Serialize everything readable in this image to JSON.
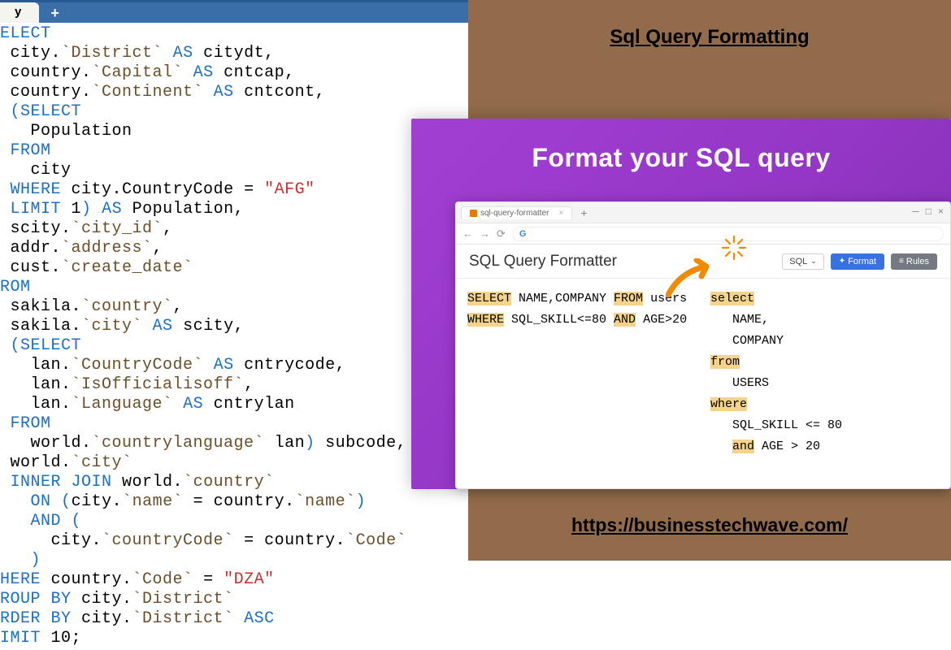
{
  "left": {
    "tab_label": "y",
    "add_tab_glyph": "+",
    "sql_tokens": [
      {
        "t": "kw",
        "v": "ELECT"
      },
      {
        "t": "nl"
      },
      {
        "t": "txt",
        "v": " city."
      },
      {
        "t": "id",
        "v": "`District`"
      },
      {
        "t": "txt",
        "v": " "
      },
      {
        "t": "kw",
        "v": "AS"
      },
      {
        "t": "txt",
        "v": " citydt,"
      },
      {
        "t": "nl"
      },
      {
        "t": "txt",
        "v": " country."
      },
      {
        "t": "id",
        "v": "`Capital`"
      },
      {
        "t": "txt",
        "v": " "
      },
      {
        "t": "kw",
        "v": "AS"
      },
      {
        "t": "txt",
        "v": " cntcap,"
      },
      {
        "t": "nl"
      },
      {
        "t": "txt",
        "v": " country."
      },
      {
        "t": "id",
        "v": "`Continent`"
      },
      {
        "t": "txt",
        "v": " "
      },
      {
        "t": "kw",
        "v": "AS"
      },
      {
        "t": "txt",
        "v": " cntcont,"
      },
      {
        "t": "nl"
      },
      {
        "t": "txt",
        "v": " "
      },
      {
        "t": "paren",
        "v": "("
      },
      {
        "t": "kw",
        "v": "SELECT"
      },
      {
        "t": "nl"
      },
      {
        "t": "txt",
        "v": "   Population"
      },
      {
        "t": "nl"
      },
      {
        "t": "txt",
        "v": " "
      },
      {
        "t": "kw",
        "v": "FROM"
      },
      {
        "t": "nl"
      },
      {
        "t": "txt",
        "v": "   city"
      },
      {
        "t": "nl"
      },
      {
        "t": "txt",
        "v": " "
      },
      {
        "t": "kw",
        "v": "WHERE"
      },
      {
        "t": "txt",
        "v": " city.CountryCode = "
      },
      {
        "t": "str",
        "v": "\"AFG\""
      },
      {
        "t": "nl"
      },
      {
        "t": "txt",
        "v": " "
      },
      {
        "t": "kw",
        "v": "LIMIT"
      },
      {
        "t": "txt",
        "v": " 1"
      },
      {
        "t": "paren",
        "v": ")"
      },
      {
        "t": "txt",
        "v": " "
      },
      {
        "t": "kw",
        "v": "AS"
      },
      {
        "t": "txt",
        "v": " Population,"
      },
      {
        "t": "nl"
      },
      {
        "t": "txt",
        "v": " scity."
      },
      {
        "t": "id",
        "v": "`city_id`"
      },
      {
        "t": "txt",
        "v": ","
      },
      {
        "t": "nl"
      },
      {
        "t": "txt",
        "v": " addr."
      },
      {
        "t": "id",
        "v": "`address`"
      },
      {
        "t": "txt",
        "v": ","
      },
      {
        "t": "nl"
      },
      {
        "t": "txt",
        "v": " cust."
      },
      {
        "t": "id",
        "v": "`create_date`"
      },
      {
        "t": "nl"
      },
      {
        "t": "kw",
        "v": "ROM"
      },
      {
        "t": "nl"
      },
      {
        "t": "txt",
        "v": " sakila."
      },
      {
        "t": "id",
        "v": "`country`"
      },
      {
        "t": "txt",
        "v": ","
      },
      {
        "t": "nl"
      },
      {
        "t": "txt",
        "v": " sakila."
      },
      {
        "t": "id",
        "v": "`city`"
      },
      {
        "t": "txt",
        "v": " "
      },
      {
        "t": "kw",
        "v": "AS"
      },
      {
        "t": "txt",
        "v": " scity,"
      },
      {
        "t": "nl"
      },
      {
        "t": "txt",
        "v": " "
      },
      {
        "t": "paren",
        "v": "("
      },
      {
        "t": "kw",
        "v": "SELECT"
      },
      {
        "t": "nl"
      },
      {
        "t": "txt",
        "v": "   lan."
      },
      {
        "t": "id",
        "v": "`CountryCode`"
      },
      {
        "t": "txt",
        "v": " "
      },
      {
        "t": "kw",
        "v": "AS"
      },
      {
        "t": "txt",
        "v": " cntrycode,"
      },
      {
        "t": "nl"
      },
      {
        "t": "txt",
        "v": "   lan."
      },
      {
        "t": "id",
        "v": "`IsOfficialisoff`"
      },
      {
        "t": "txt",
        "v": ","
      },
      {
        "t": "nl"
      },
      {
        "t": "txt",
        "v": "   lan."
      },
      {
        "t": "id",
        "v": "`Language`"
      },
      {
        "t": "txt",
        "v": " "
      },
      {
        "t": "kw",
        "v": "AS"
      },
      {
        "t": "txt",
        "v": " cntrylan"
      },
      {
        "t": "nl"
      },
      {
        "t": "txt",
        "v": " "
      },
      {
        "t": "kw",
        "v": "FROM"
      },
      {
        "t": "nl"
      },
      {
        "t": "txt",
        "v": "   world."
      },
      {
        "t": "id",
        "v": "`countrylanguage`"
      },
      {
        "t": "txt",
        "v": " lan"
      },
      {
        "t": "paren",
        "v": ")"
      },
      {
        "t": "txt",
        "v": " subcode,"
      },
      {
        "t": "nl"
      },
      {
        "t": "txt",
        "v": " world."
      },
      {
        "t": "id",
        "v": "`city`"
      },
      {
        "t": "nl"
      },
      {
        "t": "txt",
        "v": " "
      },
      {
        "t": "kw",
        "v": "INNER JOIN"
      },
      {
        "t": "txt",
        "v": " world."
      },
      {
        "t": "id",
        "v": "`country`"
      },
      {
        "t": "nl"
      },
      {
        "t": "txt",
        "v": "   "
      },
      {
        "t": "kw",
        "v": "ON"
      },
      {
        "t": "txt",
        "v": " "
      },
      {
        "t": "paren",
        "v": "("
      },
      {
        "t": "txt",
        "v": "city."
      },
      {
        "t": "id",
        "v": "`name`"
      },
      {
        "t": "txt",
        "v": " = country."
      },
      {
        "t": "id",
        "v": "`name`"
      },
      {
        "t": "paren",
        "v": ")"
      },
      {
        "t": "nl"
      },
      {
        "t": "txt",
        "v": "   "
      },
      {
        "t": "kw",
        "v": "AND"
      },
      {
        "t": "txt",
        "v": " "
      },
      {
        "t": "paren",
        "v": "("
      },
      {
        "t": "nl"
      },
      {
        "t": "txt",
        "v": "     city."
      },
      {
        "t": "id",
        "v": "`countryCode`"
      },
      {
        "t": "txt",
        "v": " = country."
      },
      {
        "t": "id",
        "v": "`Code`"
      },
      {
        "t": "nl"
      },
      {
        "t": "txt",
        "v": "   "
      },
      {
        "t": "paren",
        "v": ")"
      },
      {
        "t": "nl"
      },
      {
        "t": "kw",
        "v": "HERE"
      },
      {
        "t": "txt",
        "v": " country."
      },
      {
        "t": "id",
        "v": "`Code`"
      },
      {
        "t": "txt",
        "v": " = "
      },
      {
        "t": "str",
        "v": "\"DZA\""
      },
      {
        "t": "nl"
      },
      {
        "t": "kw",
        "v": "ROUP BY"
      },
      {
        "t": "txt",
        "v": " city."
      },
      {
        "t": "id",
        "v": "`District`"
      },
      {
        "t": "nl"
      },
      {
        "t": "kw",
        "v": "RDER BY"
      },
      {
        "t": "txt",
        "v": " city."
      },
      {
        "t": "id",
        "v": "`District`"
      },
      {
        "t": "txt",
        "v": " "
      },
      {
        "t": "kw",
        "v": "ASC"
      },
      {
        "t": "nl"
      },
      {
        "t": "kw",
        "v": "IMIT"
      },
      {
        "t": "txt",
        "v": " 10;"
      }
    ]
  },
  "right": {
    "title": "Sql Query Formatting",
    "url": "https://businesstechwave.com/"
  },
  "purple": {
    "headline": "Format your SQL query"
  },
  "browser": {
    "tab_title": "sql-query-formatter",
    "addr_text": "G",
    "app_title": "SQL Query Formatter",
    "select_label": "SQL",
    "format_btn": "Format",
    "rules_btn": "Rules",
    "input_tokens": [
      {
        "t": "hk",
        "v": "SELECT"
      },
      {
        "t": "txt",
        "v": " NAME,COMPANY "
      },
      {
        "t": "hk",
        "v": "FROM"
      },
      {
        "t": "txt",
        "v": " users"
      },
      {
        "t": "nl"
      },
      {
        "t": "hk",
        "v": "WHERE"
      },
      {
        "t": "txt",
        "v": " SQL_SKILL<=80 "
      },
      {
        "t": "hk",
        "v": "AND"
      },
      {
        "t": "txt",
        "v": " AGE>20"
      }
    ],
    "output_tokens": [
      {
        "t": "hk",
        "v": "select"
      },
      {
        "t": "nl"
      },
      {
        "t": "txt",
        "v": "   NAME,"
      },
      {
        "t": "nl"
      },
      {
        "t": "txt",
        "v": "   COMPANY"
      },
      {
        "t": "nl"
      },
      {
        "t": "hk",
        "v": "from"
      },
      {
        "t": "nl"
      },
      {
        "t": "txt",
        "v": "   USERS"
      },
      {
        "t": "nl"
      },
      {
        "t": "hk",
        "v": "where"
      },
      {
        "t": "nl"
      },
      {
        "t": "txt",
        "v": "   SQL_SKILL <= 80"
      },
      {
        "t": "nl"
      },
      {
        "t": "txt",
        "v": "   "
      },
      {
        "t": "hk",
        "v": "and"
      },
      {
        "t": "txt",
        "v": " AGE > 20"
      }
    ]
  }
}
